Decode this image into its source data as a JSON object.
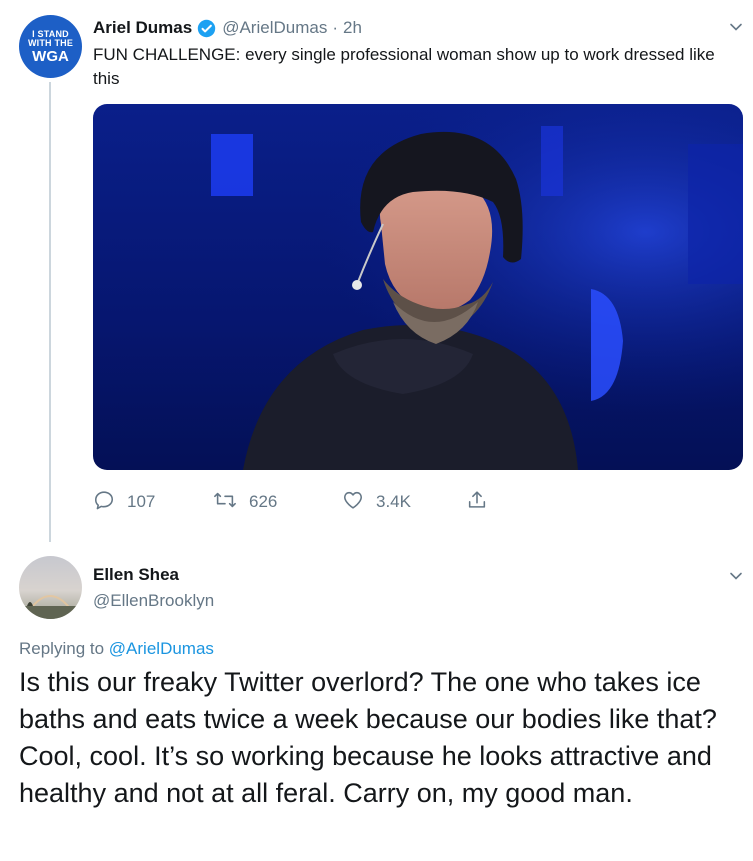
{
  "tweet1": {
    "avatar_lines": [
      "I STAND",
      "WITH THE",
      "WGA"
    ],
    "display_name": "Ariel Dumas",
    "handle": "@ArielDumas",
    "separator": "·",
    "time": "2h",
    "text": "FUN CHALLENGE: every single professional woman show up to work dressed like this",
    "actions": {
      "replies": "107",
      "retweets": "626",
      "likes": "3.4K"
    }
  },
  "tweet2": {
    "display_name": "Ellen Shea",
    "handle": "@EllenBrooklyn",
    "replying_prefix": "Replying to",
    "replying_to": "@ArielDumas",
    "text": "Is this our freaky Twitter overlord? The one who takes ice baths and eats twice a week because our bodies like that? Cool, cool. It’s so working because he looks attractive and healthy and not at all feral. Carry on, my good man."
  },
  "colors": {
    "accent": "#1da1f2",
    "link": "#1b95e0",
    "secondary_text": "#657786",
    "avatar_blue": "#1d5fc6"
  },
  "icons": [
    "verified-badge-icon",
    "chevron-down-icon",
    "reply-icon",
    "retweet-icon",
    "like-icon",
    "share-icon"
  ]
}
